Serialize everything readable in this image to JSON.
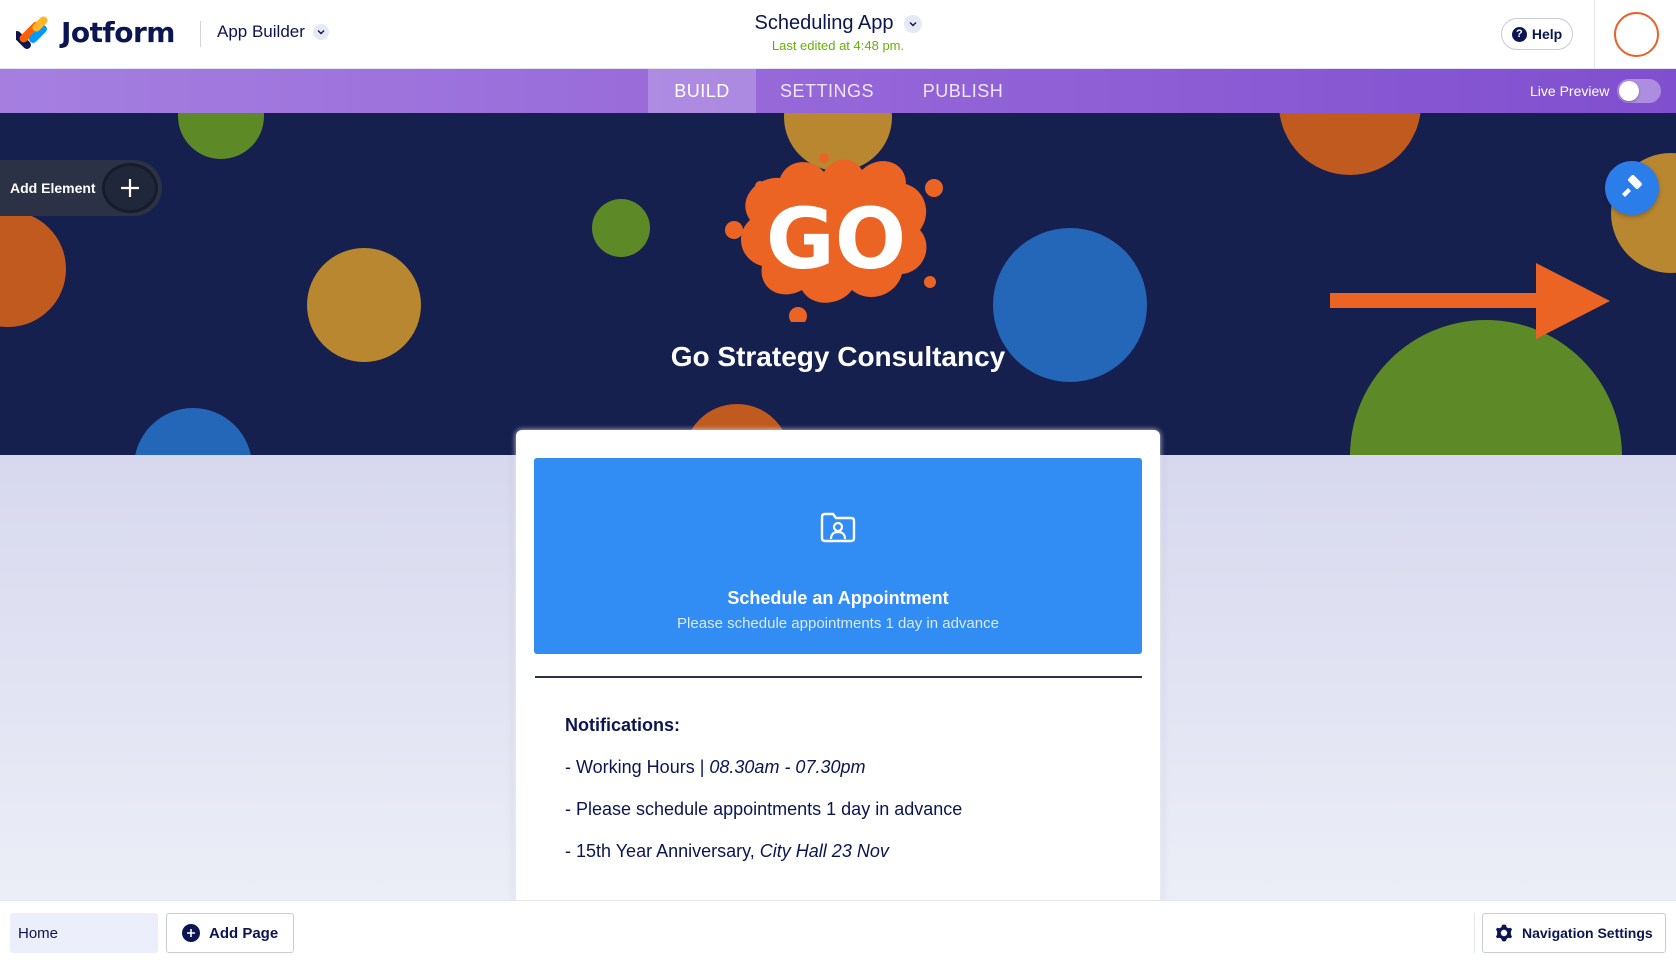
{
  "header": {
    "logo_text": "Jotform",
    "product": "App Builder",
    "app_title": "Scheduling App",
    "last_edited": "Last edited at 4:48 pm.",
    "help_label": "Help"
  },
  "nav": {
    "tabs": [
      {
        "label": "BUILD",
        "active": true
      },
      {
        "label": "SETTINGS",
        "active": false
      },
      {
        "label": "PUBLISH",
        "active": false
      }
    ],
    "live_preview_label": "Live Preview",
    "live_preview_on": false
  },
  "hero": {
    "logo_text": "GO",
    "title": "Go Strategy Consultancy"
  },
  "toolbox": {
    "add_element_label": "Add Element"
  },
  "card": {
    "appointment": {
      "title": "Schedule an Appointment",
      "subtitle": "Please schedule appointments 1 day in advance"
    },
    "notifications": {
      "heading": "Notifications:",
      "items": [
        {
          "text": "- Working Hours | ",
          "emphasis": "08.30am - 07.30pm"
        },
        {
          "text": "- Please schedule appointments 1 day in advance",
          "emphasis": ""
        },
        {
          "text": "- 15th Year Anniversary, ",
          "emphasis": "City Hall 23 Nov"
        }
      ]
    }
  },
  "footer": {
    "pages": [
      {
        "label": "Home"
      }
    ],
    "add_page_label": "Add Page",
    "nav_settings_label": "Navigation Settings"
  },
  "colors": {
    "hero_bg": "#16204f",
    "accent_blue": "#318cf4",
    "brand_orange": "#ec6424",
    "nav_purple": "#9566d8",
    "last_edited_green": "#64b200"
  }
}
